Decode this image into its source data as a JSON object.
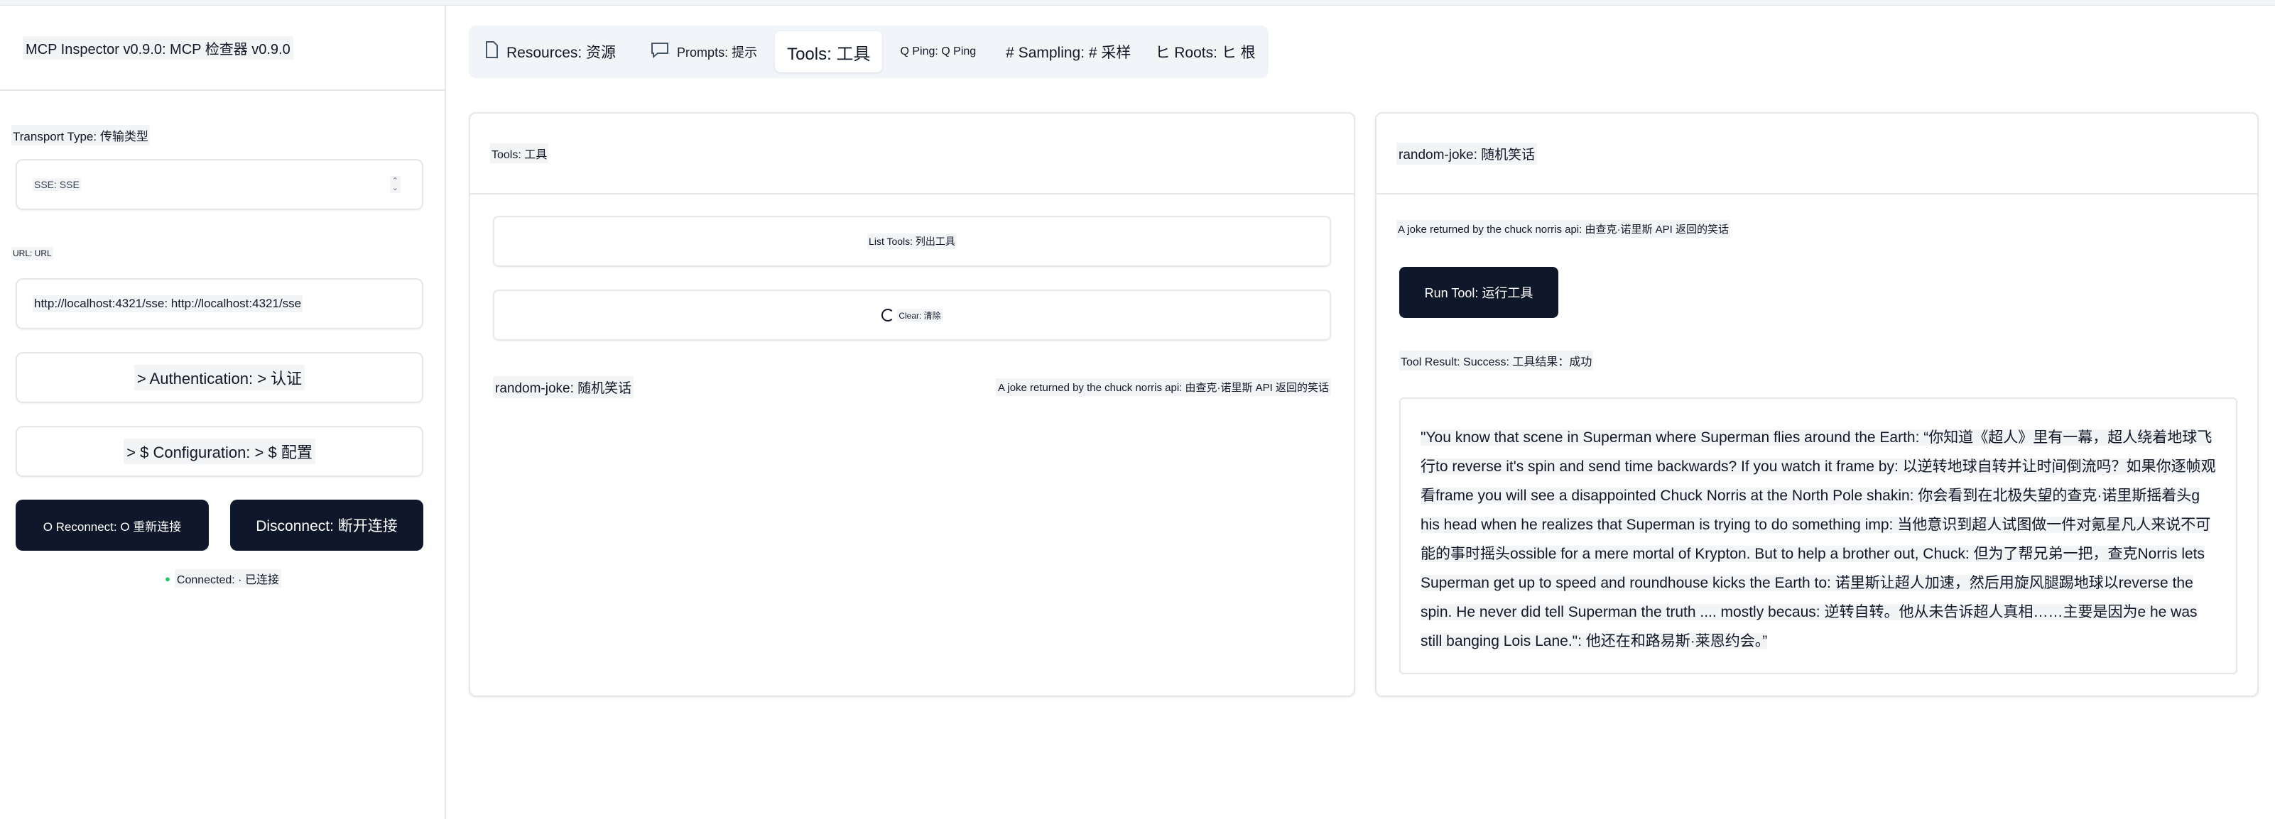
{
  "sidebar": {
    "title": "MCP Inspector v0.9.0: MCP 检查器 v0.9.0",
    "transport_label": "Transport Type: 传输类型",
    "transport_value": "SSE: SSE",
    "url_label": "URL: URL",
    "url_value": "http://localhost:4321/sse: http://localhost:4321/sse",
    "auth_label": "> Authentication: > 认证",
    "config_label": "> $ Configuration: > $ 配置",
    "reconnect_label": "O Reconnect: O 重新连接",
    "disconnect_label": "Disconnect: 断开连接",
    "status_label": "Connected: · 已连接",
    "status_color": "#22c55e"
  },
  "tabs": [
    {
      "icon": "file-icon",
      "label": "Resources: 资源",
      "active": false
    },
    {
      "icon": "message-icon",
      "label": "Prompts: 提示",
      "active": false
    },
    {
      "icon": "",
      "label": "Tools: 工具",
      "active": true
    },
    {
      "icon": "",
      "label": "Q Ping: Q Ping",
      "active": false
    },
    {
      "icon": "",
      "label": "# Sampling: # 采样",
      "active": false
    },
    {
      "icon": "",
      "label": "ヒ Roots: ヒ 根",
      "active": false
    }
  ],
  "tools_panel": {
    "title": "Tools: 工具",
    "list_button": "List Tools: 列出工具",
    "clear_button": "Clear: 清除",
    "tool_name": "random-joke: 随机笑话",
    "tool_description": "A joke returned by the chuck norris api: 由查克·诺里斯 API 返回的笑话"
  },
  "detail_panel": {
    "title": "random-joke: 随机笑话",
    "description": "A joke returned by the chuck norris api: 由查克·诺里斯 API 返回的笑话",
    "run_button": "Run Tool: 运行工具",
    "result_label": "Tool Result: Success: 工具结果：成功",
    "result_text": "\"You know that scene in Superman where Superman flies around the Earth: “你知道《超人》里有一幕，超人绕着地球飞行to reverse it's spin and send time backwards? If you watch it frame by: 以逆转地球自转并让时间倒流吗？如果你逐帧观看frame you will see a disappointed Chuck Norris at the North Pole shakin: 你会看到在北极失望的查克·诺里斯摇着头g his head when he realizes that Superman is trying to do something imp: 当他意识到超人试图做一件对氪星凡人来说不可能的事时摇头ossible for a mere mortal of Krypton. But to help a brother out, Chuck: 但为了帮兄弟一把，查克Norris lets Superman get up to speed and roundhouse kicks the Earth to: 诺里斯让超人加速，然后用旋风腿踢地球以reverse the spin. He never did tell Superman the truth .... mostly becaus: 逆转自转。他从未告诉超人真相……主要是因为e he was still banging Lois Lane.\": 他还在和路易斯·莱恩约会。”"
  }
}
